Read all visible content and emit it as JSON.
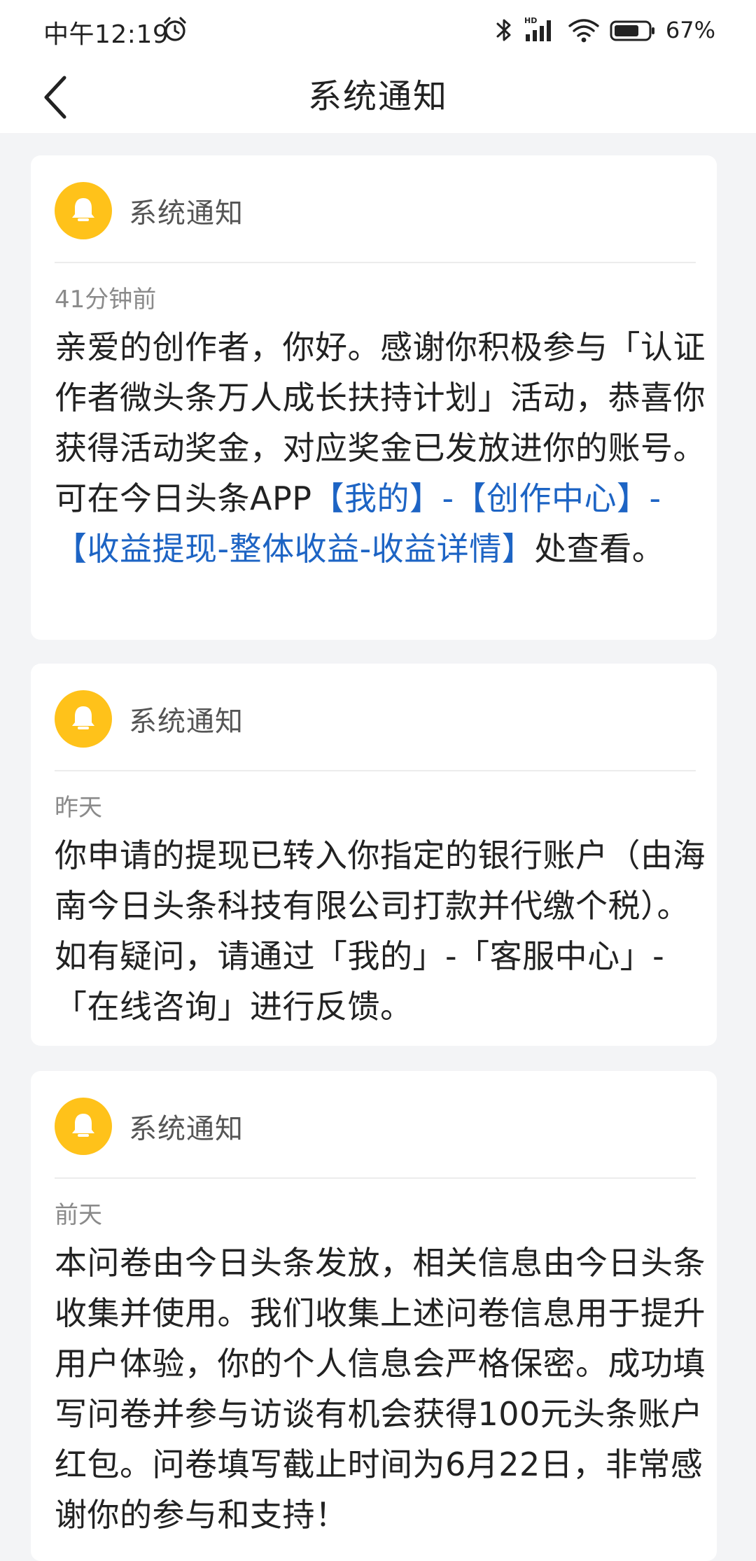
{
  "status_bar": {
    "time": "中午12:19",
    "battery": "67%"
  },
  "header": {
    "title": "系统通知"
  },
  "notifications": [
    {
      "sender": "系统通知",
      "time": "41分钟前",
      "body_before": "亲爱的创作者，你好。感谢你积极参与「认证作者微头条万人成长扶持计划」活动，恭喜你获得活动奖金，对应奖金已发放进你的账号。可在今日头条APP",
      "link_text": "【我的】-【创作中心】-【收益提现-整体收益-收益详情】",
      "body_after": "处查看。"
    },
    {
      "sender": "系统通知",
      "time": "昨天",
      "body": "你申请的提现已转入你指定的银行账户（由海南今日头条科技有限公司打款并代缴个税）。如有疑问，请通过「我的」-「客服中心」-「在线咨询」进行反馈。"
    },
    {
      "sender": "系统通知",
      "time": "前天",
      "body": "本问卷由今日头条发放，相关信息由今日头条收集并使用。我们收集上述问卷信息用于提升用户体验，你的个人信息会严格保密。成功填写问卷并参与访谈有机会获得100元头条账户红包。问卷填写截止时间为6月22日，非常感谢你的参与和支持！"
    }
  ],
  "colors": {
    "accent_link": "#1d64c4",
    "bell_yellow": "#ffc21a",
    "page_background": "#f3f4f6"
  }
}
